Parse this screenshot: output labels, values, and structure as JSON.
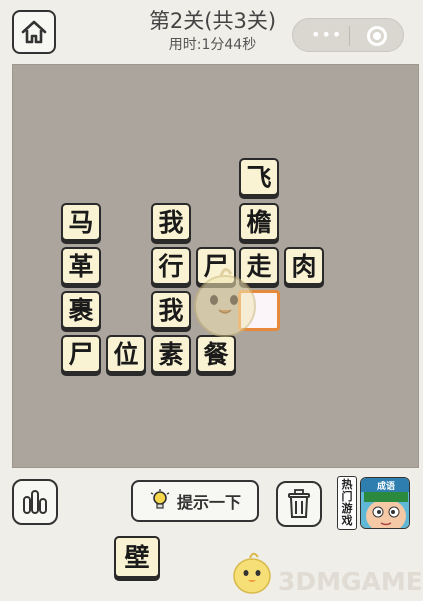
{
  "header": {
    "title": "第2关(共3关)",
    "timer": "用时:1分44秒",
    "capsule_more": "•••"
  },
  "board": {
    "tiles": [
      {
        "char": "飞"
      },
      {
        "char": "马"
      },
      {
        "char": "我"
      },
      {
        "char": "檐"
      },
      {
        "char": "革"
      },
      {
        "char": "行"
      },
      {
        "char": "尸"
      },
      {
        "char": "走"
      },
      {
        "char": "肉"
      },
      {
        "char": "裹"
      },
      {
        "char": "我"
      },
      {
        "char": ""
      },
      {
        "char": "尸"
      },
      {
        "char": "位"
      },
      {
        "char": "素"
      },
      {
        "char": "餐"
      }
    ]
  },
  "toolbar": {
    "hint_label": "提示一下",
    "hot_games_label": [
      "热",
      "门",
      "游",
      "戏"
    ],
    "game_thumb_label": "成语"
  },
  "candidates": [
    {
      "char": "壁"
    }
  ],
  "watermark": {
    "brand": "3DMGAME"
  }
}
